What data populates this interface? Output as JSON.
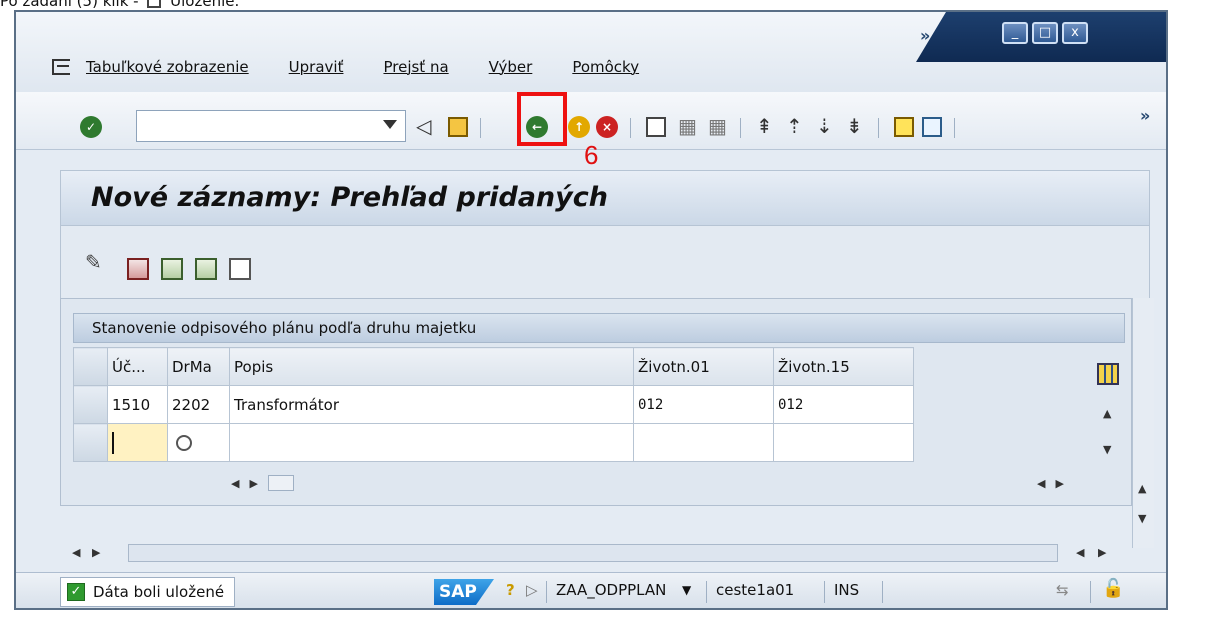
{
  "caption": "Po zadaní (5) klik -",
  "caption_tail": "Uloženie.",
  "window": {
    "controls": [
      "_",
      "□",
      "x"
    ],
    "overflow_glyph": "»"
  },
  "menu": {
    "items": [
      "Tabuľkové zobrazenie",
      "Upraviť",
      "Prejsť na",
      "Výber",
      "Pomôcky"
    ]
  },
  "toolbar": {
    "command_field_value": "",
    "overflow_glyph": "»",
    "highlight_label": "6"
  },
  "screen": {
    "title": "Nové záznamy: Prehľad pridaných"
  },
  "group": {
    "title": "Stanovenie odpisového plánu podľa druhu majetku"
  },
  "table": {
    "columns": [
      "Úč...",
      "DrMa",
      "Popis",
      "Životn.01",
      "Životn.15"
    ],
    "rows": [
      [
        "1510",
        "2202",
        "Transformátor",
        "012",
        "012"
      ]
    ]
  },
  "statusbar": {
    "message": "Dáta boli uložené",
    "logo_text": "SAP",
    "transaction": "ZAA_ODPPLAN",
    "user": "ceste1a01",
    "mode": "INS"
  },
  "colors": {
    "highlight": "#ee1111",
    "window_border": "#5a6f86",
    "title_tab": "#1d3f6e",
    "required_field": "#fff2c2"
  }
}
